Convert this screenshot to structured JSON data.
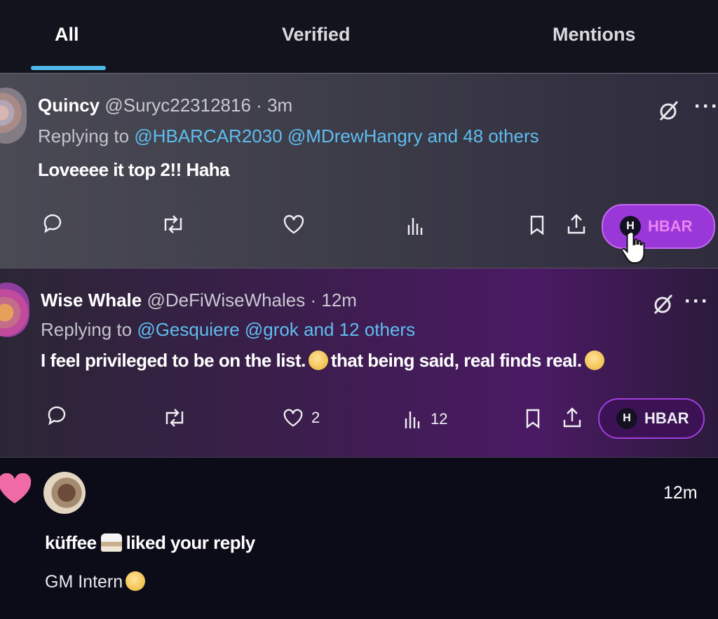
{
  "tabs": [
    {
      "label": "All",
      "active": true
    },
    {
      "label": "Verified",
      "active": false
    },
    {
      "label": "Mentions",
      "active": false
    }
  ],
  "posts": [
    {
      "name": "Quincy",
      "handle": "@Suryc22312816",
      "separator": "·",
      "time": "3m",
      "replying_prefix": "Replying to ",
      "mentions": "@HBARCAR2030 @MDrewHangry and 48 others",
      "text": "Loveeee it top 2!! Haha",
      "likes": "",
      "views": "",
      "hbar_label": "HBAR"
    },
    {
      "name": "Wise Whale",
      "handle": "@DeFiWiseWhales",
      "separator": "·",
      "time": "12m",
      "replying_prefix": "Replying to ",
      "mentions": "@Gesquiere @grok and 12 others",
      "text_a": "I feel privileged to be on the list.",
      "text_b": "that being said, real finds real.",
      "likes": "2",
      "views": "12",
      "hbar_label": "HBAR"
    }
  ],
  "notification": {
    "time": "12m",
    "user": "küffee",
    "action": "liked your reply",
    "snippet": "GM Intern"
  },
  "icons": {
    "reply": "comment-icon",
    "repost": "repost-icon",
    "like": "heart-icon",
    "views": "analytics-icon",
    "bookmark": "bookmark-icon",
    "share": "share-icon",
    "grok": "grok-slash-icon",
    "more": "more-icon"
  },
  "colors": {
    "accent": "#4fb8e8",
    "mention": "#5fbdf0",
    "hbar_pill": "#9a37d8",
    "like_heart": "#f06aa6"
  }
}
